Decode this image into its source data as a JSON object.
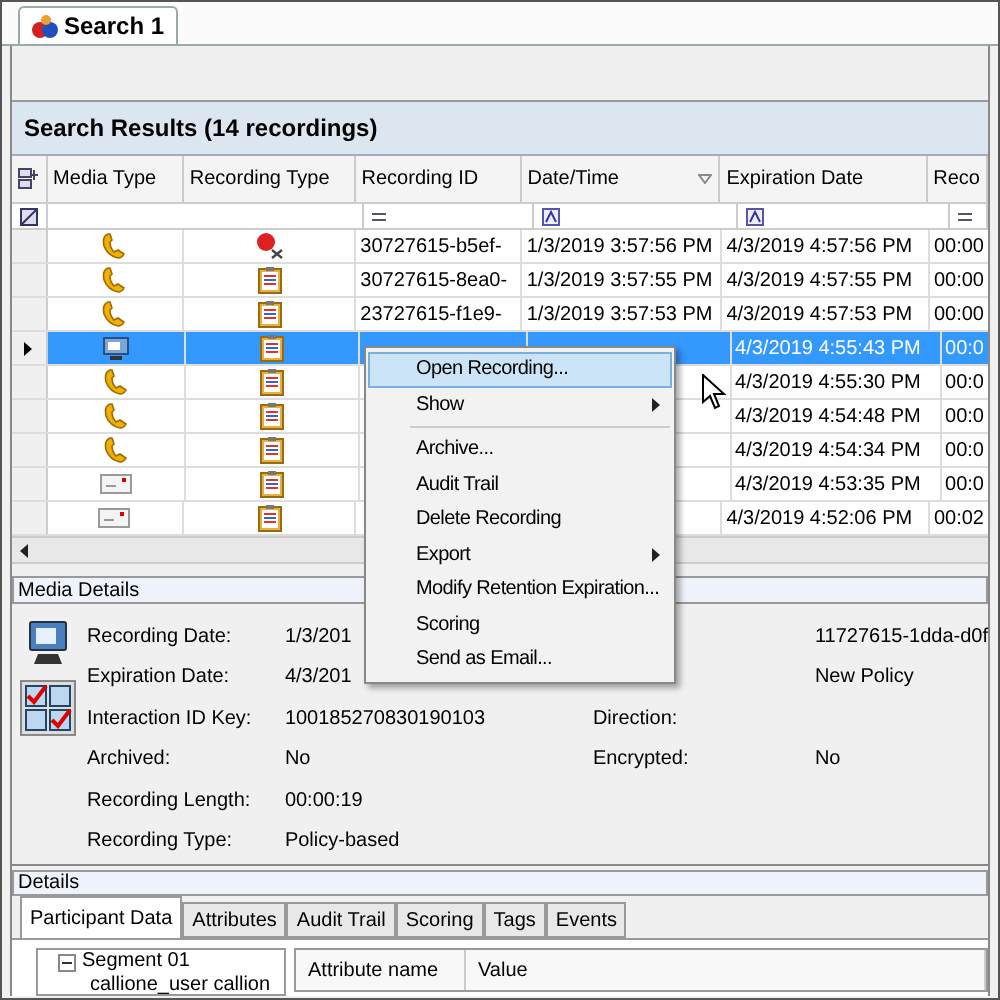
{
  "tab": {
    "label": "Search 1",
    "selected": true
  },
  "results": {
    "title": "Search Results (14 recordings)",
    "columns": [
      {
        "label": "Media Type",
        "sorted": false
      },
      {
        "label": "Recording Type",
        "sorted": false
      },
      {
        "label": "Recording ID",
        "sorted": false
      },
      {
        "label": "Date/Time",
        "sorted": true
      },
      {
        "label": "Expiration Date",
        "sorted": false
      },
      {
        "label": "Reco",
        "sorted": false
      }
    ],
    "rows": [
      {
        "media_icon": {
          "kind": "phone"
        },
        "type_icon": {
          "kind": "deleted"
        },
        "selected": false,
        "id": "30727615-b5ef-",
        "datetime": "1/3/2019 3:57:56 PM",
        "expiration": "4/3/2019 4:57:56 PM",
        "col6": "00:00"
      },
      {
        "media_icon": {
          "kind": "phone"
        },
        "type_icon": {
          "kind": "policy"
        },
        "selected": false,
        "id": "30727615-8ea0-",
        "datetime": "1/3/2019 3:57:55 PM",
        "expiration": "4/3/2019 4:57:55 PM",
        "col6": "00:00"
      },
      {
        "media_icon": {
          "kind": "phone"
        },
        "type_icon": {
          "kind": "policy"
        },
        "selected": false,
        "id": "23727615-f1e9-",
        "datetime": "1/3/2019 3:57:53 PM",
        "expiration": "4/3/2019 4:57:53 PM",
        "col6": "00:00"
      },
      {
        "media_icon": {
          "kind": "screen"
        },
        "type_icon": {
          "kind": "policy"
        },
        "selected": true,
        "expiration": "4/3/2019 4:55:43 PM",
        "col6": "00:0"
      },
      {
        "media_icon": {
          "kind": "phone"
        },
        "type_icon": {
          "kind": "policy"
        },
        "selected": false,
        "expiration": "4/3/2019 4:55:30 PM",
        "col6": "00:0"
      },
      {
        "media_icon": {
          "kind": "phone"
        },
        "type_icon": {
          "kind": "policy"
        },
        "selected": false,
        "expiration": "4/3/2019 4:54:48 PM",
        "col6": "00:0"
      },
      {
        "media_icon": {
          "kind": "phone"
        },
        "type_icon": {
          "kind": "policy"
        },
        "selected": false,
        "expiration": "4/3/2019 4:54:34 PM",
        "col6": "00:0"
      },
      {
        "media_icon": {
          "kind": "email"
        },
        "type_icon": {
          "kind": "policy"
        },
        "selected": false,
        "expiration": "4/3/2019 4:53:35 PM",
        "col6": "00:0"
      },
      {
        "media_icon": {
          "kind": "email"
        },
        "type_icon": {
          "kind": "policy"
        },
        "selected": false,
        "expiration": "4/3/2019 4:52:06 PM",
        "col6": "00:02"
      }
    ]
  },
  "context_menu": [
    {
      "kind": "item",
      "label": "Open Recording...",
      "submenu": false,
      "selected": true
    },
    {
      "kind": "item",
      "label": "Show",
      "submenu": true,
      "selected": false
    },
    {
      "kind": "separator"
    },
    {
      "kind": "item",
      "label": "Archive...",
      "submenu": false,
      "selected": false
    },
    {
      "kind": "item",
      "label": "Audit Trail",
      "submenu": false,
      "selected": false
    },
    {
      "kind": "item",
      "label": "Delete Recording",
      "submenu": false,
      "selected": false
    },
    {
      "kind": "item",
      "label": "Export",
      "submenu": true,
      "selected": false
    },
    {
      "kind": "item",
      "label": "Modify Retention Expiration...",
      "submenu": false,
      "selected": false
    },
    {
      "kind": "item",
      "label": "Scoring",
      "submenu": false,
      "selected": false
    },
    {
      "kind": "item",
      "label": "Send as Email...",
      "submenu": false,
      "selected": false
    }
  ],
  "media_details": {
    "title": "Media Details",
    "fields": [
      {
        "label": "Recording Date:",
        "value": "1/3/201",
        "right_value": "11727615-1dda-d0f"
      },
      {
        "label": "Expiration Date:",
        "value": "4/3/201",
        "right_value": "New Policy"
      },
      {
        "label": "Interaction ID Key:",
        "value": "100185270830190103",
        "right_label": "Direction:"
      },
      {
        "label": "Archived:",
        "value": "No",
        "right_label": "Encrypted:",
        "right_value": "No"
      },
      {
        "label": "Recording Length:",
        "value": "00:00:19"
      },
      {
        "label": "Recording Type:",
        "value": "Policy-based"
      }
    ]
  },
  "details": {
    "title": "Details",
    "tabs": [
      {
        "label": "Participant Data",
        "selected": true
      },
      {
        "label": "Attributes",
        "selected": false
      },
      {
        "label": "Audit Trail",
        "selected": false
      },
      {
        "label": "Scoring",
        "selected": false
      },
      {
        "label": "Tags",
        "selected": false
      },
      {
        "label": "Events",
        "selected": false
      }
    ],
    "tree": [
      {
        "label": "Segment 01",
        "expanded": true,
        "children": [
          {
            "label": "callione_user callion"
          }
        ]
      }
    ],
    "grid_columns": [
      "Attribute name",
      "Value"
    ]
  }
}
